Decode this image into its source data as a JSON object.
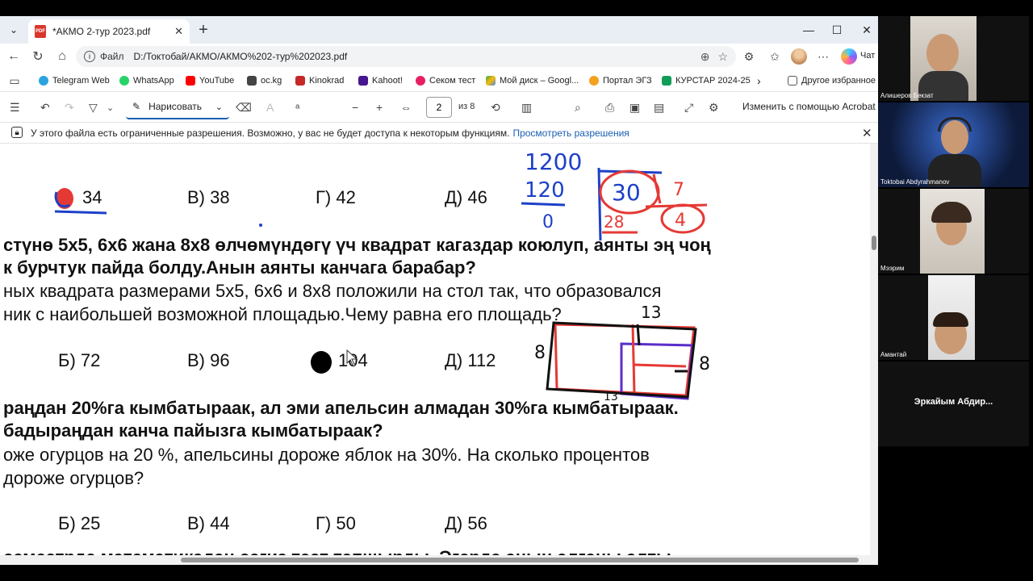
{
  "browser": {
    "tab": {
      "title": "*АКМО 2-тур 2023.pdf",
      "icon": "pdf-icon"
    },
    "address": {
      "label": "Файл",
      "url": "D:/Токтобай/АКМО/АКМО%202-тур%202023.pdf"
    },
    "chat_label": "Чат"
  },
  "bookmarks": [
    {
      "label": "Telegram Web",
      "color": "#2aa3df"
    },
    {
      "label": "WhatsApp",
      "color": "#25d366"
    },
    {
      "label": "YouTube",
      "color": "#ff0000"
    },
    {
      "label": "oc.kg",
      "color": "#444444"
    },
    {
      "label": "Kinokrad",
      "color": "#c62828"
    },
    {
      "label": "Kahoot!",
      "color": "#46178f"
    },
    {
      "label": "Секом тест",
      "color": "#e91e63"
    },
    {
      "label": "Мой диск – Googl...",
      "color": "#34a853"
    },
    {
      "label": "Портал ЭГЗ",
      "color": "#f4a020"
    },
    {
      "label": "КУРСТАР 2024-25",
      "color": "#0f9d58"
    }
  ],
  "bookmarks_other": "Другое избранное",
  "pdf_toolbar": {
    "draw_label": "Нарисовать",
    "page_current": "2",
    "page_total": "из 8",
    "acrobat_label": "Изменить с помощью Acrobat"
  },
  "infobar": {
    "text": "У этого файла есть ограниченные разрешения. Возможно, у вас не будет доступа к некоторым функциям.",
    "link": "Просмотреть разрешения"
  },
  "document": {
    "q1_options": [
      "34",
      "В) 38",
      "Г) 42",
      "Д) 46"
    ],
    "q2_line1": "стүнө 5х5, 6х6 жана 8х8 өлчөмүндөгү үч квадрат кагаздар  коюлуп, аянты эң чоң",
    "q2_line2": "к бурчтук пайда болду.Анын аянты канчага барабар?",
    "q2_line3": "ных квадрата размерами 5х5, 6х6 и 8х8 положили на стол так, что образовался",
    "q2_line4": "ник с наибольшей возможной площадью.Чему равна его площадь?",
    "q2_options": [
      "Б) 72",
      "В) 96",
      "104",
      "Д) 112"
    ],
    "q3_line1": "раңдан 20%га кымбатыраак, ал эми апельсин алмадан 30%га кымбатыраак.",
    "q3_line2": "бадыраңдан канча пайызга кымбатыраак?",
    "q3_line3": "оже огурцов на 20 %, апельсины дороже яблок на 30%. На сколько процентов",
    "q3_line4": "дороже огурцов?",
    "q3_options": [
      "Б) 25",
      "В) 44",
      "Г) 50",
      "Д) 56"
    ],
    "q4_partial": "семестрде  математикадан сегиз тест тапшырды. Эгерде анын алганы алты"
  },
  "handwriting": {
    "top": [
      "1200",
      "120",
      "0",
      "30",
      "7",
      "28",
      "4"
    ],
    "rect_top": "13",
    "rect_left": "8",
    "rect_right": "8",
    "rect_bottom": "13"
  },
  "participants": [
    {
      "name": "Алишеров Бекзат"
    },
    {
      "name": "Toktobai Abdyrahmanov"
    },
    {
      "name": "Мээрим"
    },
    {
      "name": "Амантай"
    },
    {
      "name": "Эркайым  Абдир..."
    }
  ]
}
